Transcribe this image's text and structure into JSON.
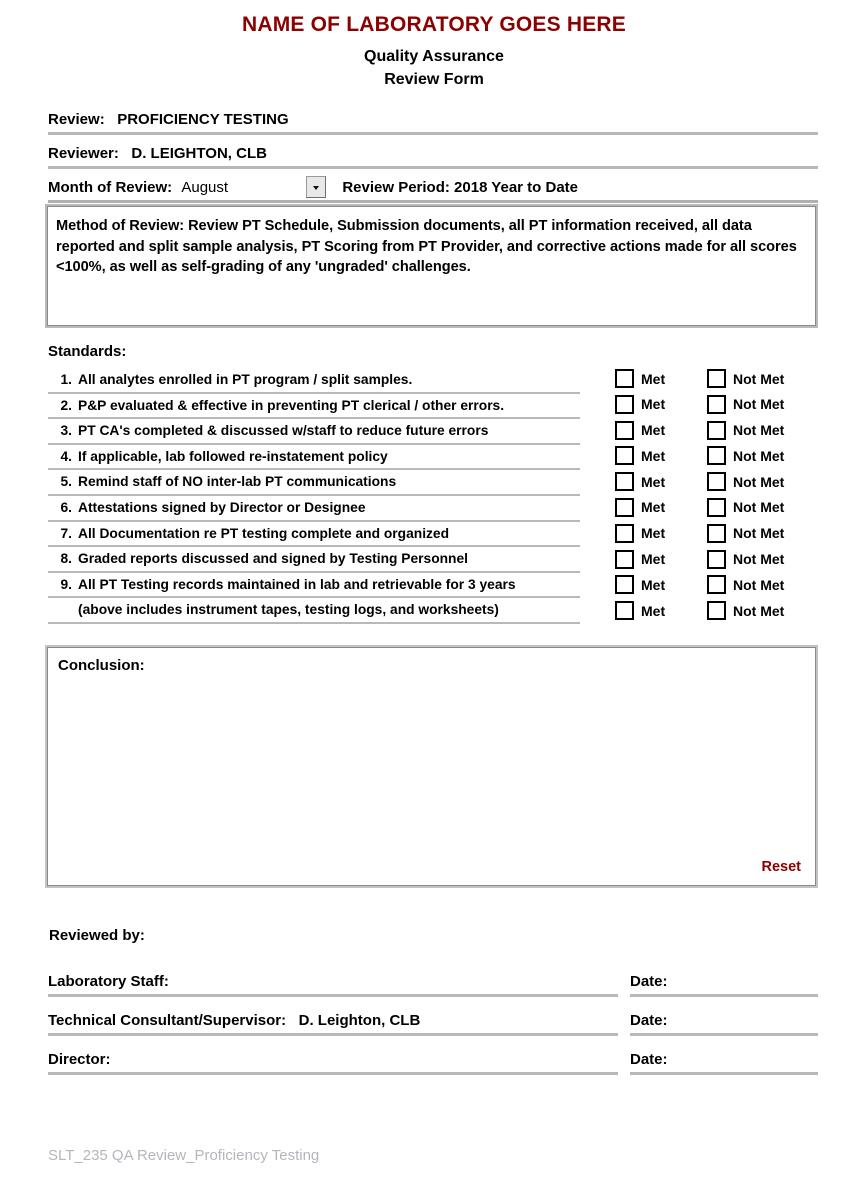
{
  "header": {
    "lab_title": "NAME OF LABORATORY GOES HERE",
    "form_title_line1": "Quality Assurance",
    "form_title_line2": "Review Form",
    "title_color": "#8B0000"
  },
  "fields": {
    "review_label": "Review:",
    "review_value": "PROFICIENCY TESTING",
    "reviewer_label": "Reviewer:",
    "reviewer_value": "D. LEIGHTON, CLB",
    "month_label": "Month of Review:",
    "month_value": "August",
    "month_options": [
      "August"
    ],
    "period_label": "Review Period:",
    "period_value": "2018 Year to Date",
    "period_full": "Review Period: 2018 Year to Date"
  },
  "method": {
    "text": "Method of Review: Review PT Schedule, Submission documents, all PT information received, all data reported and split sample analysis, PT Scoring from PT Provider, and corrective actions made for all scores <100%, as well as self-grading of any 'ungraded' challenges."
  },
  "standards": {
    "label": "Standards:",
    "met_label": "Met",
    "not_met_label": "Not Met",
    "items": [
      {
        "num": "1.",
        "text": "All analytes enrolled in PT program / split samples."
      },
      {
        "num": "2.",
        "text": "P&P evaluated & effective in preventing PT clerical / other errors."
      },
      {
        "num": "3.",
        "text": "PT CA's completed & discussed w/staff to reduce future errors"
      },
      {
        "num": "4.",
        "text": "If applicable, lab followed re-instatement policy"
      },
      {
        "num": "5.",
        "text": "Remind staff of NO inter-lab PT communications"
      },
      {
        "num": "6.",
        "text": "Attestations signed by Director or Designee"
      },
      {
        "num": "7.",
        "text": "All Documentation re PT testing complete and organized"
      },
      {
        "num": "8.",
        "text": "Graded reports discussed and signed by Testing Personnel"
      },
      {
        "num": "9.",
        "text": "All PT Testing records maintained in lab and retrievable for 3 years"
      },
      {
        "num": "",
        "text": "(above includes instrument tapes, testing logs, and worksheets)"
      }
    ]
  },
  "conclusion": {
    "label": "Conclusion:",
    "value": "",
    "reset_label": "Reset",
    "reset_color": "#8B0000"
  },
  "signatures": {
    "reviewed_by_label": "Reviewed by:",
    "rows": [
      {
        "label": "Laboratory Staff:",
        "value": "",
        "date_label": "Date:",
        "date_value": ""
      },
      {
        "label": "Technical Consultant/Supervisor:",
        "value": "D. Leighton, CLB",
        "date_label": "Date:",
        "date_value": ""
      },
      {
        "label": "Director:",
        "value": "",
        "date_label": "Date:",
        "date_value": ""
      }
    ]
  },
  "footer": {
    "document_code": "SLT_235 QA Review_Proficiency Testing"
  }
}
